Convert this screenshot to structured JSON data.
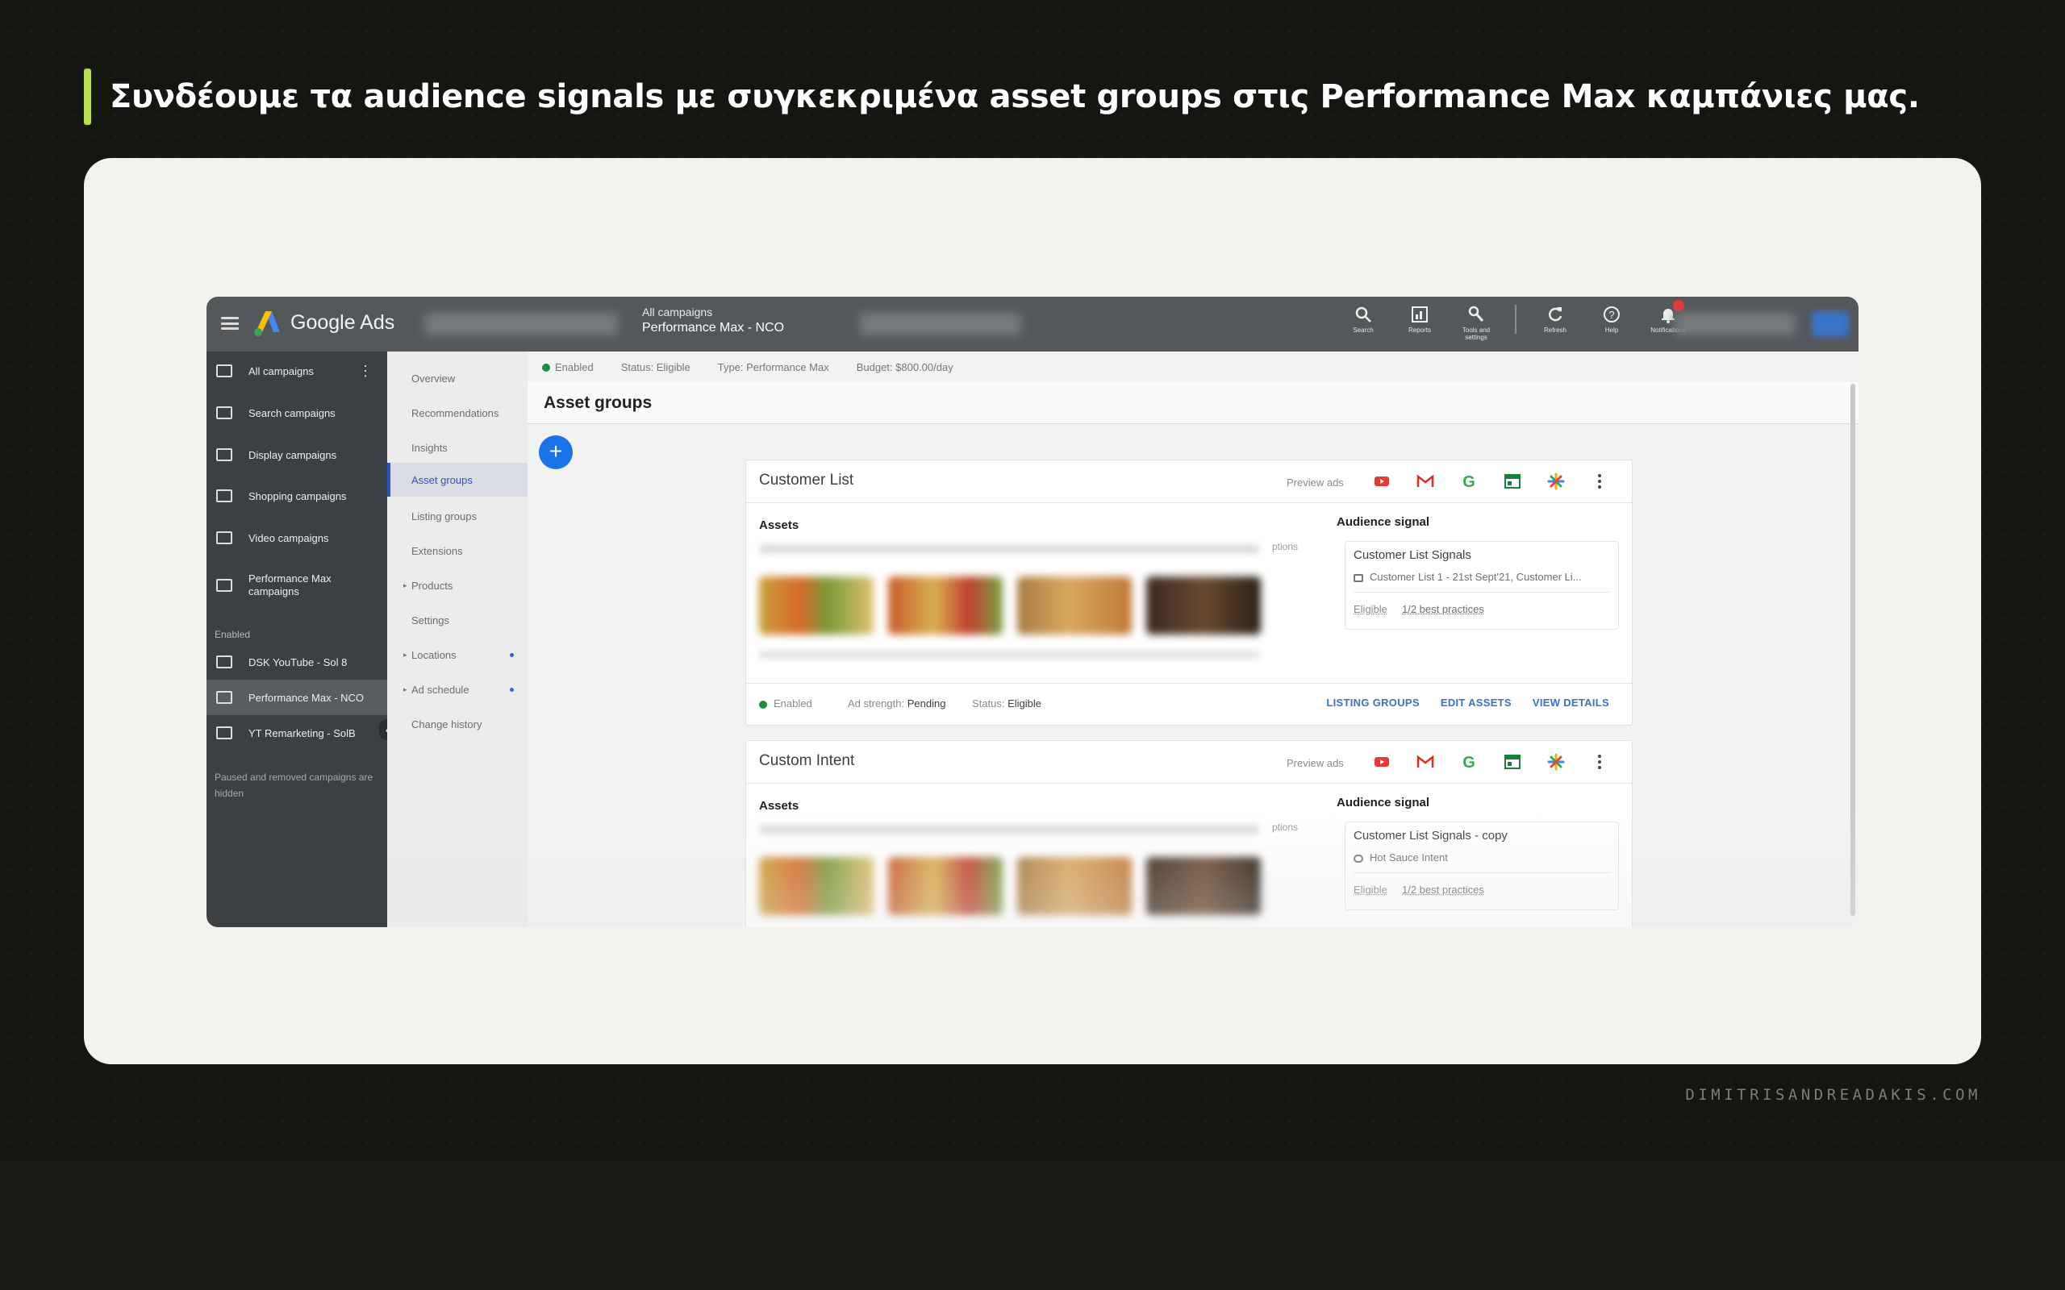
{
  "slide": {
    "heading": "Συνδέουμε τα audience signals με συγκεκριμένα asset groups στις Performance Max καμπάνιες μας.",
    "footer": "DIMITRISANDREADAKIS.COM",
    "colors": {
      "background": "#141612",
      "accent": "#b5e04a",
      "card": "#f3f2ee"
    }
  },
  "google_ads": {
    "brand": "Google Ads",
    "breadcrumb": {
      "parent": "All campaigns",
      "current": "Performance Max - NCO"
    },
    "top_icons": [
      {
        "icon": "search-icon",
        "label": "Search"
      },
      {
        "icon": "reports-icon",
        "label": "Reports"
      },
      {
        "icon": "tools-icon",
        "label": "Tools and settings"
      },
      {
        "icon": "refresh-icon",
        "label": "Refresh"
      },
      {
        "icon": "help-icon",
        "label": "Help"
      },
      {
        "icon": "bell-icon",
        "label": "Notifications"
      }
    ],
    "sidebar": {
      "items": [
        {
          "label": "All campaigns",
          "icon": "grid-icon"
        },
        {
          "label": "Search campaigns",
          "icon": "search-campaign-icon"
        },
        {
          "label": "Display campaigns",
          "icon": "display-icon"
        },
        {
          "label": "Shopping campaigns",
          "icon": "shopping-icon"
        },
        {
          "label": "Video campaigns",
          "icon": "video-icon"
        },
        {
          "label": "Performance Max campaigns",
          "icon": "performance-icon"
        }
      ],
      "section_label": "Enabled",
      "campaigns": [
        {
          "label": "DSK YouTube - Sol 8"
        },
        {
          "label": "Performance Max - NCO"
        },
        {
          "label": "YT Remarketing - SolB"
        }
      ],
      "note": "Paused and removed campaigns are hidden"
    },
    "subnav": {
      "items": [
        {
          "label": "Overview"
        },
        {
          "label": "Recommendations"
        },
        {
          "label": "Insights"
        },
        {
          "label": "Asset groups"
        },
        {
          "label": "Listing groups"
        },
        {
          "label": "Extensions"
        },
        {
          "label": "Products"
        },
        {
          "label": "Settings"
        },
        {
          "label": "Locations"
        },
        {
          "label": "Ad schedule"
        },
        {
          "label": "Change history"
        }
      ],
      "active": "Asset groups"
    },
    "status_bar": {
      "enabled": "Enabled",
      "status": "Status: Eligible",
      "type": "Type: Performance Max",
      "budget": "Budget: $800.00/day"
    },
    "page_title": "Asset groups",
    "asset_groups": [
      {
        "name": "Customer List",
        "preview_label": "Preview ads",
        "assets_label": "Assets",
        "options_text": "ptions",
        "audience_label": "Audience signal",
        "signal_name": "Customer List Signals",
        "signal_detail": "Customer List 1 - 21st Sept'21, Customer Li...",
        "eligible": "Eligible",
        "best_practices": "1/2 best practices",
        "footer": {
          "enabled": "Enabled",
          "ad_strength_label": "Ad strength:",
          "ad_strength": "Pending",
          "status_label": "Status:",
          "status": "Eligible",
          "links": [
            "LISTING GROUPS",
            "EDIT ASSETS",
            "VIEW DETAILS"
          ]
        }
      },
      {
        "name": "Custom Intent",
        "preview_label": "Preview ads",
        "assets_label": "Assets",
        "options_text": "ptions",
        "audience_label": "Audience signal",
        "signal_name": "Customer List Signals - copy",
        "signal_detail": "Hot Sauce Intent",
        "eligible": "Eligible",
        "best_practices": "1/2 best practices"
      }
    ]
  }
}
